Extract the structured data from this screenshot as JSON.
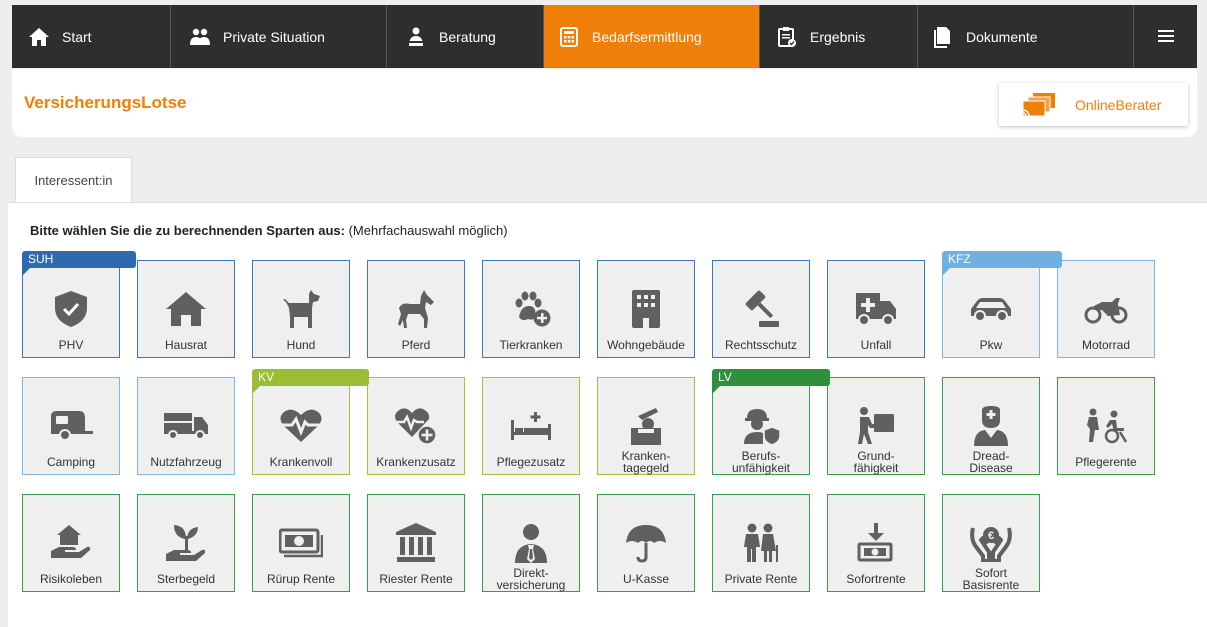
{
  "nav": {
    "items": [
      {
        "label": "Start",
        "icon": "home-icon"
      },
      {
        "label": "Private Situation",
        "icon": "people-icon"
      },
      {
        "label": "Beratung",
        "icon": "consultation-icon"
      },
      {
        "label": "Bedarfsermittlung",
        "icon": "calculator-icon",
        "active": true
      },
      {
        "label": "Ergebnis",
        "icon": "clipboard-icon"
      },
      {
        "label": "Dokumente",
        "icon": "documents-icon"
      }
    ],
    "menu_icon": "hamburger-menu-icon"
  },
  "header": {
    "brand": "VersicherungsLotse",
    "online_berater": "OnlineBerater"
  },
  "tabs": [
    {
      "label": "Interessent:in"
    }
  ],
  "instruction": {
    "bold": "Bitte wählen Sie die zu berechnenden Sparten aus:",
    "note": "(Mehrfachauswahl möglich)"
  },
  "groups": [
    {
      "label": "SUH",
      "color": "#2d6aae"
    },
    {
      "label": "KFZ",
      "color": "#6fb0e4"
    },
    {
      "label": "KV",
      "color": "#9bbd35"
    },
    {
      "label": "LV",
      "color": "#2f8f3d"
    }
  ],
  "tiles": [
    {
      "label": "PHV",
      "icon": "shield-check-icon",
      "group": "SUH"
    },
    {
      "label": "Hausrat",
      "icon": "house-icon",
      "group": "SUH"
    },
    {
      "label": "Hund",
      "icon": "dog-icon",
      "group": "SUH"
    },
    {
      "label": "Pferd",
      "icon": "horse-icon",
      "group": "SUH"
    },
    {
      "label": "Tierkranken",
      "icon": "paw-plus-icon",
      "group": "SUH"
    },
    {
      "label": "Wohngebäude",
      "icon": "building-icon",
      "group": "SUH"
    },
    {
      "label": "Rechtsschutz",
      "icon": "gavel-icon",
      "group": "SUH"
    },
    {
      "label": "Unfall",
      "icon": "ambulance-icon",
      "group": "SUH"
    },
    {
      "label": "Pkw",
      "icon": "car-icon",
      "group": "KFZ"
    },
    {
      "label": "Motorrad",
      "icon": "motorcycle-icon",
      "group": "KFZ"
    },
    {
      "label": "Camping",
      "icon": "caravan-icon",
      "group": "KFZ"
    },
    {
      "label": "Nutzfahrzeug",
      "icon": "truck-icon",
      "group": "KFZ"
    },
    {
      "label": "Krankenvoll",
      "icon": "heartbeat-icon",
      "group": "KV"
    },
    {
      "label": "Krankenzusatz",
      "icon": "heartbeat-plus-icon",
      "group": "KV"
    },
    {
      "label": "Pflegezusatz",
      "icon": "hospital-bed-icon",
      "group": "KV"
    },
    {
      "label": "Kranken-\ntagegeld",
      "icon": "coin-box-icon",
      "group": "KV"
    },
    {
      "label": "Berufs-\nunfähigkeit",
      "icon": "worker-shield-icon",
      "group": "LV"
    },
    {
      "label": "Grund-\nfähigkeit",
      "icon": "person-carrying-icon",
      "group": "LV"
    },
    {
      "label": "Dread-\nDisease",
      "icon": "doctor-icon",
      "group": "LV"
    },
    {
      "label": "Pflegerente",
      "icon": "wheelchair-care-icon",
      "group": "LV"
    },
    {
      "label": "Risikoleben",
      "icon": "hand-house-icon",
      "group": "LV"
    },
    {
      "label": "Sterbegeld",
      "icon": "hand-sprout-icon",
      "group": "LV"
    },
    {
      "label": "Rürup Rente",
      "icon": "money-bill-icon",
      "group": "LV"
    },
    {
      "label": "Riester Rente",
      "icon": "bank-icon",
      "group": "LV"
    },
    {
      "label": "Direkt-\nversicherung",
      "icon": "businessman-icon",
      "group": "LV"
    },
    {
      "label": "U-Kasse",
      "icon": "umbrella-icon",
      "group": "LV"
    },
    {
      "label": "Private Rente",
      "icon": "elderly-couple-icon",
      "group": "LV"
    },
    {
      "label": "Sofortrente",
      "icon": "money-download-icon",
      "group": "LV"
    },
    {
      "label": "Sofort\nBasisrente",
      "icon": "hands-euro-icon",
      "group": "LV"
    }
  ]
}
